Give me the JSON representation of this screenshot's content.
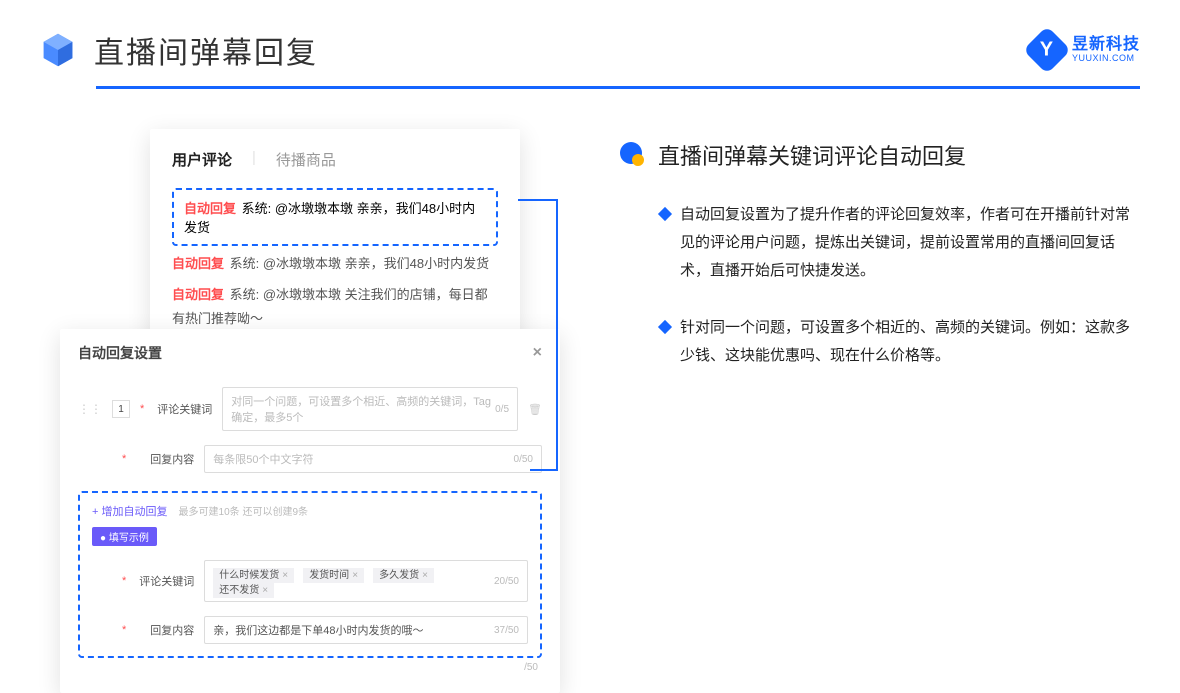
{
  "header": {
    "title": "直播间弹幕回复",
    "brand_cn": "昱新科技",
    "brand_en": "YUUXIN.COM",
    "brand_letter": "Y"
  },
  "comments_panel": {
    "tab_active": "用户评论",
    "tab_inactive": "待播商品",
    "highlighted": {
      "prefix": "自动回复",
      "text": " 系统: @冰墩墩本墩 亲亲，我们48小时内发货"
    },
    "rows": [
      {
        "prefix": "自动回复",
        "text": " 系统: @冰墩墩本墩 亲亲，我们48小时内发货"
      },
      {
        "prefix": "自动回复",
        "text": " 系统: @冰墩墩本墩 关注我们的店铺，每日都有热门推荐呦～"
      }
    ]
  },
  "settings_panel": {
    "title": "自动回复设置",
    "idx": "1",
    "field1_label": "评论关键词",
    "field1_placeholder": "对同一个问题，可设置多个相近、高频的关键词，Tag确定，最多5个",
    "field1_counter": "0/5",
    "field2_label": "回复内容",
    "field2_placeholder": "每条限50个中文字符",
    "field2_counter": "0/50",
    "add_link": "+ 增加自动回复",
    "add_hint": "最多可建10条 还可以创建9条",
    "example_badge": "● 填写示例",
    "ex_kw_label": "评论关键词",
    "ex_tags": [
      "什么时候发货",
      "发货时间",
      "多久发货",
      "还不发货"
    ],
    "ex_kw_counter": "20/50",
    "ex_reply_label": "回复内容",
    "ex_reply_value": "亲，我们这边都是下单48小时内发货的哦～",
    "ex_reply_counter": "37/50",
    "outer_counter": "/50"
  },
  "right": {
    "section_title": "直播间弹幕关键词评论自动回复",
    "bullet1": "自动回复设置为了提升作者的评论回复效率，作者可在开播前针对常见的评论用户问题，提炼出关键词，提前设置常用的直播间回复话术，直播开始后可快捷发送。",
    "bullet2": "针对同一个问题，可设置多个相近的、高频的关键词。例如：这款多少钱、这块能优惠吗、现在什么价格等。"
  }
}
